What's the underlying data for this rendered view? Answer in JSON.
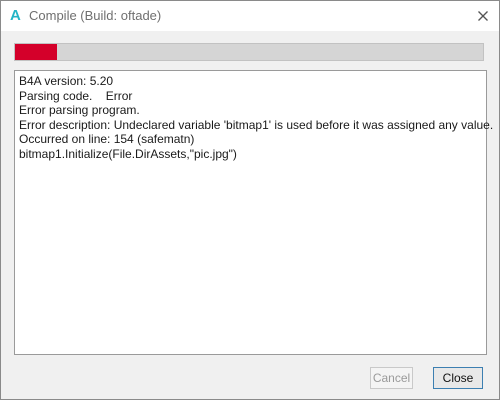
{
  "window": {
    "app_icon_glyph": "A",
    "title": "Compile (Build: oftade)",
    "close_icon": "close-icon"
  },
  "progress": {
    "percent": 9,
    "fill_color": "#d4002a",
    "track_color": "#d5d5d5"
  },
  "log": {
    "lines": [
      "B4A version: 5.20",
      "Parsing code.    Error",
      "Error parsing program.",
      "Error description: Undeclared variable 'bitmap1' is used before it was assigned any value.",
      "Occurred on line: 154 (safematn)",
      "bitmap1.Initialize(File.DirAssets,\"pic.jpg\")"
    ]
  },
  "buttons": {
    "cancel_label": "Cancel",
    "cancel_enabled": false,
    "close_label": "Close"
  },
  "colors": {
    "accent": "#25b5c6",
    "focus_border": "#3c7fb1"
  }
}
